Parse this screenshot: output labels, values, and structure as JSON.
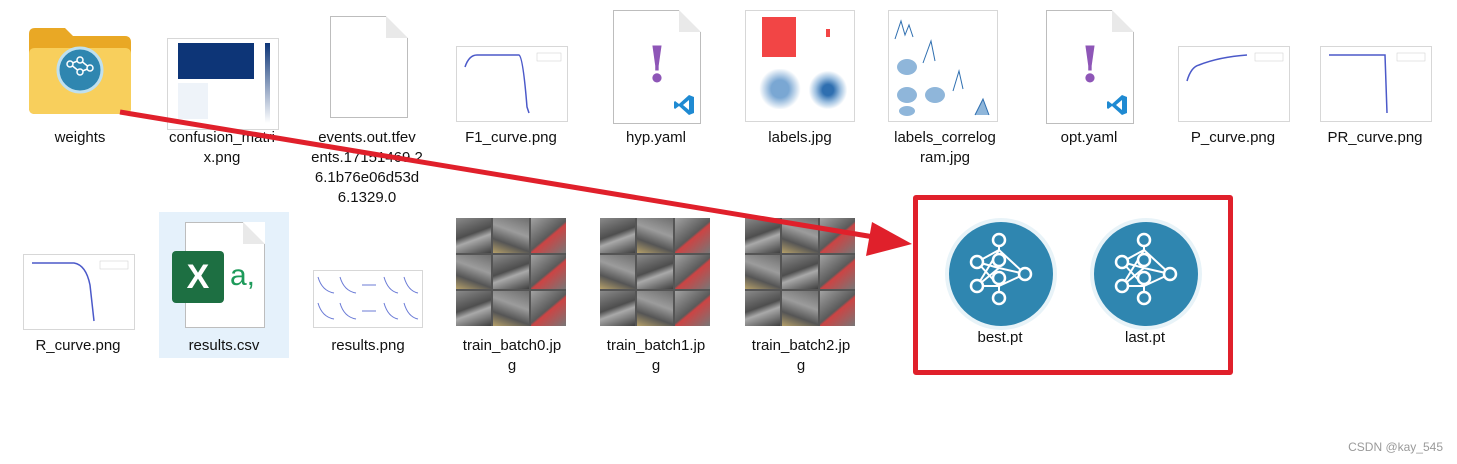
{
  "files_row1": [
    {
      "name": "weights",
      "type": "folder"
    },
    {
      "name": "confusion_matrix.png",
      "type": "png"
    },
    {
      "name": "events.out.tfevents.1715146926.1b76e06d53d6.1329.0",
      "type": "file"
    },
    {
      "name": "F1_curve.png",
      "type": "png"
    },
    {
      "name": "hyp.yaml",
      "type": "yaml"
    },
    {
      "name": "labels.jpg",
      "type": "jpg"
    },
    {
      "name": "labels_correlogram.jpg",
      "type": "jpg"
    },
    {
      "name": "opt.yaml",
      "type": "yaml"
    },
    {
      "name": "P_curve.png",
      "type": "png"
    },
    {
      "name": "PR_curve.png",
      "type": "png"
    }
  ],
  "files_row2": [
    {
      "name": "R_curve.png",
      "type": "png"
    },
    {
      "name": "results.csv",
      "type": "csv"
    },
    {
      "name": "results.png",
      "type": "png"
    },
    {
      "name": "train_batch0.jpg",
      "type": "jpg"
    },
    {
      "name": "train_batch1.jpg",
      "type": "jpg"
    },
    {
      "name": "train_batch2.jpg",
      "type": "jpg"
    }
  ],
  "labels": {
    "weights": "weights",
    "confusion": "confusion_matri\nx.png",
    "events": "events.out.tfev\nents.17151469 2\n6.1b76e06d53d\n6.1329.0",
    "f1": "F1_curve.png",
    "hyp": "hyp.yaml",
    "labels": "labels.jpg",
    "correlogram": "labels_correlog\nram.jpg",
    "opt": "opt.yaml",
    "p": "P_curve.png",
    "pr": "PR_curve.png",
    "r": "R_curve.png",
    "results_csv": "results.csv",
    "results_png": "results.png",
    "tb0": "train_batch0.jp\ng",
    "tb1": "train_batch1.jp\ng",
    "tb2": "train_batch2.jp\ng"
  },
  "weights_contents": [
    {
      "name": "best.pt",
      "icon": "neural-network-icon"
    },
    {
      "name": "last.pt",
      "icon": "neural-network-icon"
    }
  ],
  "watermark": "CSDN @kay_545",
  "colors": {
    "highlight": "#e0202b",
    "arrow": "#e0202b",
    "selected_bg": "#e5f1fb",
    "folder": "#f6c443",
    "excel": "#1d6f42",
    "vscode": "#1f8ad2",
    "yaml_mark": "#8e56b7",
    "nn_icon": "#2f86b0"
  }
}
